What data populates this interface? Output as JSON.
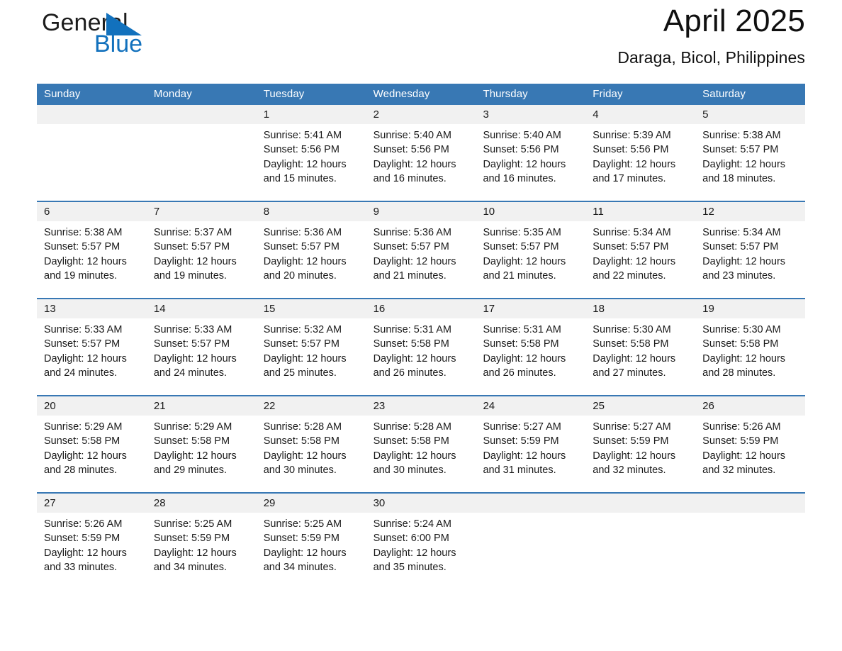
{
  "brand": {
    "name_part1": "General",
    "name_part2": "Blue",
    "triangle_color": "#1271bd"
  },
  "header": {
    "month_title": "April 2025",
    "location": "Daraga, Bicol, Philippines"
  },
  "theme": {
    "header_blue": "#3878b4",
    "band_gray": "#f1f1f1",
    "text": "#1a1a1a"
  },
  "weekdays": [
    "Sunday",
    "Monday",
    "Tuesday",
    "Wednesday",
    "Thursday",
    "Friday",
    "Saturday"
  ],
  "weeks": [
    {
      "days": [
        {
          "num": "",
          "sunrise": "",
          "sunset": "",
          "daylight_l1": "",
          "daylight_l2": ""
        },
        {
          "num": "",
          "sunrise": "",
          "sunset": "",
          "daylight_l1": "",
          "daylight_l2": ""
        },
        {
          "num": "1",
          "sunrise": "Sunrise: 5:41 AM",
          "sunset": "Sunset: 5:56 PM",
          "daylight_l1": "Daylight: 12 hours",
          "daylight_l2": "and 15 minutes."
        },
        {
          "num": "2",
          "sunrise": "Sunrise: 5:40 AM",
          "sunset": "Sunset: 5:56 PM",
          "daylight_l1": "Daylight: 12 hours",
          "daylight_l2": "and 16 minutes."
        },
        {
          "num": "3",
          "sunrise": "Sunrise: 5:40 AM",
          "sunset": "Sunset: 5:56 PM",
          "daylight_l1": "Daylight: 12 hours",
          "daylight_l2": "and 16 minutes."
        },
        {
          "num": "4",
          "sunrise": "Sunrise: 5:39 AM",
          "sunset": "Sunset: 5:56 PM",
          "daylight_l1": "Daylight: 12 hours",
          "daylight_l2": "and 17 minutes."
        },
        {
          "num": "5",
          "sunrise": "Sunrise: 5:38 AM",
          "sunset": "Sunset: 5:57 PM",
          "daylight_l1": "Daylight: 12 hours",
          "daylight_l2": "and 18 minutes."
        }
      ]
    },
    {
      "days": [
        {
          "num": "6",
          "sunrise": "Sunrise: 5:38 AM",
          "sunset": "Sunset: 5:57 PM",
          "daylight_l1": "Daylight: 12 hours",
          "daylight_l2": "and 19 minutes."
        },
        {
          "num": "7",
          "sunrise": "Sunrise: 5:37 AM",
          "sunset": "Sunset: 5:57 PM",
          "daylight_l1": "Daylight: 12 hours",
          "daylight_l2": "and 19 minutes."
        },
        {
          "num": "8",
          "sunrise": "Sunrise: 5:36 AM",
          "sunset": "Sunset: 5:57 PM",
          "daylight_l1": "Daylight: 12 hours",
          "daylight_l2": "and 20 minutes."
        },
        {
          "num": "9",
          "sunrise": "Sunrise: 5:36 AM",
          "sunset": "Sunset: 5:57 PM",
          "daylight_l1": "Daylight: 12 hours",
          "daylight_l2": "and 21 minutes."
        },
        {
          "num": "10",
          "sunrise": "Sunrise: 5:35 AM",
          "sunset": "Sunset: 5:57 PM",
          "daylight_l1": "Daylight: 12 hours",
          "daylight_l2": "and 21 minutes."
        },
        {
          "num": "11",
          "sunrise": "Sunrise: 5:34 AM",
          "sunset": "Sunset: 5:57 PM",
          "daylight_l1": "Daylight: 12 hours",
          "daylight_l2": "and 22 minutes."
        },
        {
          "num": "12",
          "sunrise": "Sunrise: 5:34 AM",
          "sunset": "Sunset: 5:57 PM",
          "daylight_l1": "Daylight: 12 hours",
          "daylight_l2": "and 23 minutes."
        }
      ]
    },
    {
      "days": [
        {
          "num": "13",
          "sunrise": "Sunrise: 5:33 AM",
          "sunset": "Sunset: 5:57 PM",
          "daylight_l1": "Daylight: 12 hours",
          "daylight_l2": "and 24 minutes."
        },
        {
          "num": "14",
          "sunrise": "Sunrise: 5:33 AM",
          "sunset": "Sunset: 5:57 PM",
          "daylight_l1": "Daylight: 12 hours",
          "daylight_l2": "and 24 minutes."
        },
        {
          "num": "15",
          "sunrise": "Sunrise: 5:32 AM",
          "sunset": "Sunset: 5:57 PM",
          "daylight_l1": "Daylight: 12 hours",
          "daylight_l2": "and 25 minutes."
        },
        {
          "num": "16",
          "sunrise": "Sunrise: 5:31 AM",
          "sunset": "Sunset: 5:58 PM",
          "daylight_l1": "Daylight: 12 hours",
          "daylight_l2": "and 26 minutes."
        },
        {
          "num": "17",
          "sunrise": "Sunrise: 5:31 AM",
          "sunset": "Sunset: 5:58 PM",
          "daylight_l1": "Daylight: 12 hours",
          "daylight_l2": "and 26 minutes."
        },
        {
          "num": "18",
          "sunrise": "Sunrise: 5:30 AM",
          "sunset": "Sunset: 5:58 PM",
          "daylight_l1": "Daylight: 12 hours",
          "daylight_l2": "and 27 minutes."
        },
        {
          "num": "19",
          "sunrise": "Sunrise: 5:30 AM",
          "sunset": "Sunset: 5:58 PM",
          "daylight_l1": "Daylight: 12 hours",
          "daylight_l2": "and 28 minutes."
        }
      ]
    },
    {
      "days": [
        {
          "num": "20",
          "sunrise": "Sunrise: 5:29 AM",
          "sunset": "Sunset: 5:58 PM",
          "daylight_l1": "Daylight: 12 hours",
          "daylight_l2": "and 28 minutes."
        },
        {
          "num": "21",
          "sunrise": "Sunrise: 5:29 AM",
          "sunset": "Sunset: 5:58 PM",
          "daylight_l1": "Daylight: 12 hours",
          "daylight_l2": "and 29 minutes."
        },
        {
          "num": "22",
          "sunrise": "Sunrise: 5:28 AM",
          "sunset": "Sunset: 5:58 PM",
          "daylight_l1": "Daylight: 12 hours",
          "daylight_l2": "and 30 minutes."
        },
        {
          "num": "23",
          "sunrise": "Sunrise: 5:28 AM",
          "sunset": "Sunset: 5:58 PM",
          "daylight_l1": "Daylight: 12 hours",
          "daylight_l2": "and 30 minutes."
        },
        {
          "num": "24",
          "sunrise": "Sunrise: 5:27 AM",
          "sunset": "Sunset: 5:59 PM",
          "daylight_l1": "Daylight: 12 hours",
          "daylight_l2": "and 31 minutes."
        },
        {
          "num": "25",
          "sunrise": "Sunrise: 5:27 AM",
          "sunset": "Sunset: 5:59 PM",
          "daylight_l1": "Daylight: 12 hours",
          "daylight_l2": "and 32 minutes."
        },
        {
          "num": "26",
          "sunrise": "Sunrise: 5:26 AM",
          "sunset": "Sunset: 5:59 PM",
          "daylight_l1": "Daylight: 12 hours",
          "daylight_l2": "and 32 minutes."
        }
      ]
    },
    {
      "days": [
        {
          "num": "27",
          "sunrise": "Sunrise: 5:26 AM",
          "sunset": "Sunset: 5:59 PM",
          "daylight_l1": "Daylight: 12 hours",
          "daylight_l2": "and 33 minutes."
        },
        {
          "num": "28",
          "sunrise": "Sunrise: 5:25 AM",
          "sunset": "Sunset: 5:59 PM",
          "daylight_l1": "Daylight: 12 hours",
          "daylight_l2": "and 34 minutes."
        },
        {
          "num": "29",
          "sunrise": "Sunrise: 5:25 AM",
          "sunset": "Sunset: 5:59 PM",
          "daylight_l1": "Daylight: 12 hours",
          "daylight_l2": "and 34 minutes."
        },
        {
          "num": "30",
          "sunrise": "Sunrise: 5:24 AM",
          "sunset": "Sunset: 6:00 PM",
          "daylight_l1": "Daylight: 12 hours",
          "daylight_l2": "and 35 minutes."
        },
        {
          "num": "",
          "sunrise": "",
          "sunset": "",
          "daylight_l1": "",
          "daylight_l2": ""
        },
        {
          "num": "",
          "sunrise": "",
          "sunset": "",
          "daylight_l1": "",
          "daylight_l2": ""
        },
        {
          "num": "",
          "sunrise": "",
          "sunset": "",
          "daylight_l1": "",
          "daylight_l2": ""
        }
      ]
    }
  ]
}
